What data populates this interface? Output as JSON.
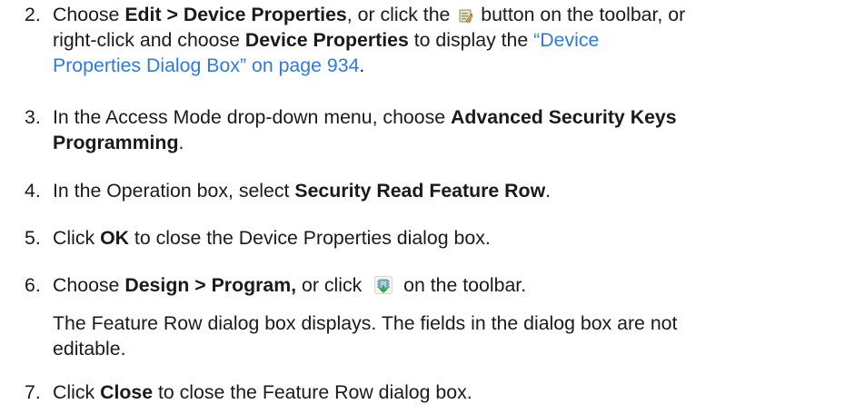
{
  "steps": [
    {
      "number": "2.",
      "line1_pre": "Choose ",
      "line1_bold1": "Edit > Device Properties",
      "line1_mid": ", or click the ",
      "line1_post": " button on the toolbar, or",
      "line2_pre": "right-click and choose ",
      "line2_bold": "Device Properties",
      "line2_post": " to display the ",
      "line2_link": "“Device",
      "line3_link": "Properties Dialog Box” on page 934",
      "line3_post": ".",
      "icon": "device-properties-icon"
    },
    {
      "number": "3.",
      "line1_pre": "In the Access Mode drop-down menu, choose ",
      "line1_bold": "Advanced Security Keys",
      "line2_bold": "Programming",
      "line2_post": "."
    },
    {
      "number": "4.",
      "pre": "In the Operation box, select ",
      "bold": "Security Read Feature Row",
      "post": "."
    },
    {
      "number": "5.",
      "pre": "Click ",
      "bold": "OK",
      "post": " to close the Device Properties dialog box."
    },
    {
      "number": "6.",
      "pre": "Choose ",
      "bold": "Design > Program,",
      "mid": " or click ",
      "post": " on the toolbar.",
      "icon": "program-icon",
      "note_line1": "The Feature Row dialog box displays. The fields in the dialog box are not",
      "note_line2": "editable."
    },
    {
      "number": "7.",
      "pre": "Click ",
      "bold": "Close",
      "post": " to close the Feature Row dialog box."
    }
  ],
  "colors": {
    "text": "#1a1a1a",
    "link": "#2f7bdc"
  }
}
